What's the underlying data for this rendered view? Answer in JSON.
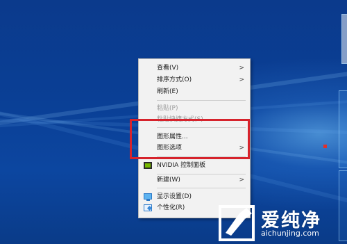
{
  "context_menu": {
    "items": [
      {
        "label": "查看(V)",
        "submenu": true,
        "disabled": false
      },
      {
        "label": "排序方式(O)",
        "submenu": true,
        "disabled": false
      },
      {
        "label": "刷新(E)",
        "submenu": false,
        "disabled": false
      },
      {
        "label": "粘贴(P)",
        "submenu": false,
        "disabled": true
      },
      {
        "label": "粘贴快捷方式(S)",
        "submenu": false,
        "disabled": true
      },
      {
        "label": "图形属性...",
        "submenu": false,
        "disabled": false
      },
      {
        "label": "图形选项",
        "submenu": true,
        "disabled": false
      },
      {
        "label": "NVIDIA 控制面板",
        "submenu": false,
        "disabled": false,
        "icon": "nvidia-icon"
      },
      {
        "label": "新建(W)",
        "submenu": true,
        "disabled": false
      },
      {
        "label": "显示设置(D)",
        "submenu": false,
        "disabled": false,
        "icon": "display-settings-icon"
      },
      {
        "label": "个性化(R)",
        "submenu": false,
        "disabled": false,
        "icon": "personalize-icon"
      }
    ],
    "submenu_arrow": ">"
  },
  "annotation": {
    "highlight_color": "#d6232c"
  },
  "watermark": {
    "brand_cn": "爱纯净",
    "url": "aichunjing.com"
  },
  "colors": {
    "desktop_blue": "#0b3a8c",
    "menu_bg": "#f2f2f2",
    "nvidia_green": "#76b900"
  }
}
